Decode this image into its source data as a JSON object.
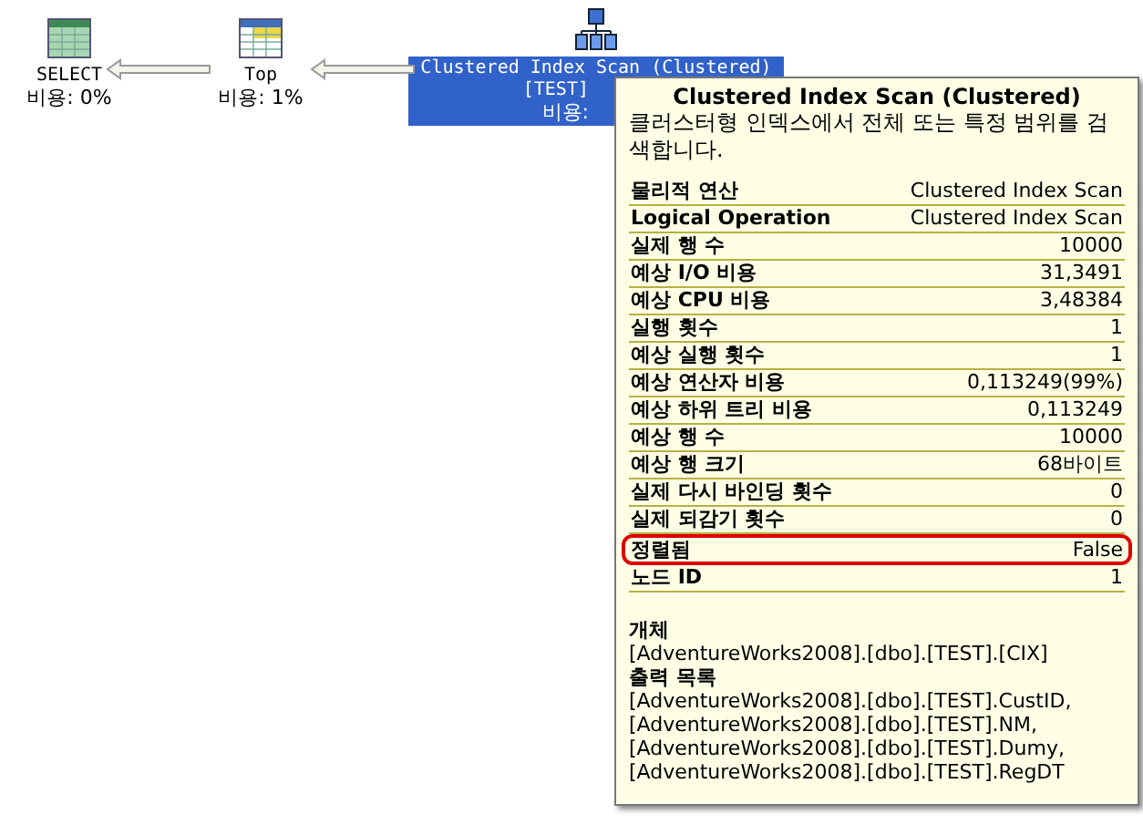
{
  "plan_nodes": [
    {
      "kind": "select",
      "label": "SELECT",
      "cost": "비용: 0%",
      "selected": false
    },
    {
      "kind": "top",
      "label": "Top",
      "cost": "비용: 1%",
      "selected": false
    },
    {
      "kind": "scan",
      "label": "Clustered Index Scan (Clustered)",
      "sub": "[TEST]",
      "cost": "비용:",
      "selected": true
    }
  ],
  "tooltip": {
    "title": "Clustered Index Scan (Clustered)",
    "description": "클러스터형 인덱스에서 전체 또는 특정 범위를 검색합니다.",
    "properties": [
      {
        "name": "물리적 연산",
        "value": "Clustered Index Scan",
        "highlighted": false
      },
      {
        "name": "Logical Operation",
        "value": "Clustered Index Scan",
        "highlighted": false
      },
      {
        "name": "실제 행 수",
        "value": "10000",
        "highlighted": false
      },
      {
        "name": "예상 I/O 비용",
        "value": "31,3491",
        "highlighted": false
      },
      {
        "name": "예상 CPU 비용",
        "value": "3,48384",
        "highlighted": false
      },
      {
        "name": "실행 횟수",
        "value": "1",
        "highlighted": false
      },
      {
        "name": "예상 실행 횟수",
        "value": "1",
        "highlighted": false
      },
      {
        "name": "예상 연산자 비용",
        "value": "0,113249(99%)",
        "highlighted": false
      },
      {
        "name": "예상 하위 트리 비용",
        "value": "0,113249",
        "highlighted": false
      },
      {
        "name": "예상 행 수",
        "value": "10000",
        "highlighted": false
      },
      {
        "name": "예상 행 크기",
        "value": "68바이트",
        "highlighted": false
      },
      {
        "name": "실제 다시 바인딩 횟수",
        "value": "0",
        "highlighted": false
      },
      {
        "name": "실제 되감기 횟수",
        "value": "0",
        "highlighted": false
      },
      {
        "name": "정렬됨",
        "value": "False",
        "highlighted": true
      },
      {
        "name": "노드 ID",
        "value": "1",
        "highlighted": false
      }
    ],
    "sections": [
      {
        "heading": "개체",
        "lines": [
          "[AdventureWorks2008].[dbo].[TEST].[CIX]"
        ]
      },
      {
        "heading": "출력 목록",
        "lines": [
          "[AdventureWorks2008].[dbo].[TEST].CustID,",
          "[AdventureWorks2008].[dbo].[TEST].NM,",
          "[AdventureWorks2008].[dbo].[TEST].Dumy,",
          "[AdventureWorks2008].[dbo].[TEST].RegDT"
        ]
      }
    ]
  }
}
